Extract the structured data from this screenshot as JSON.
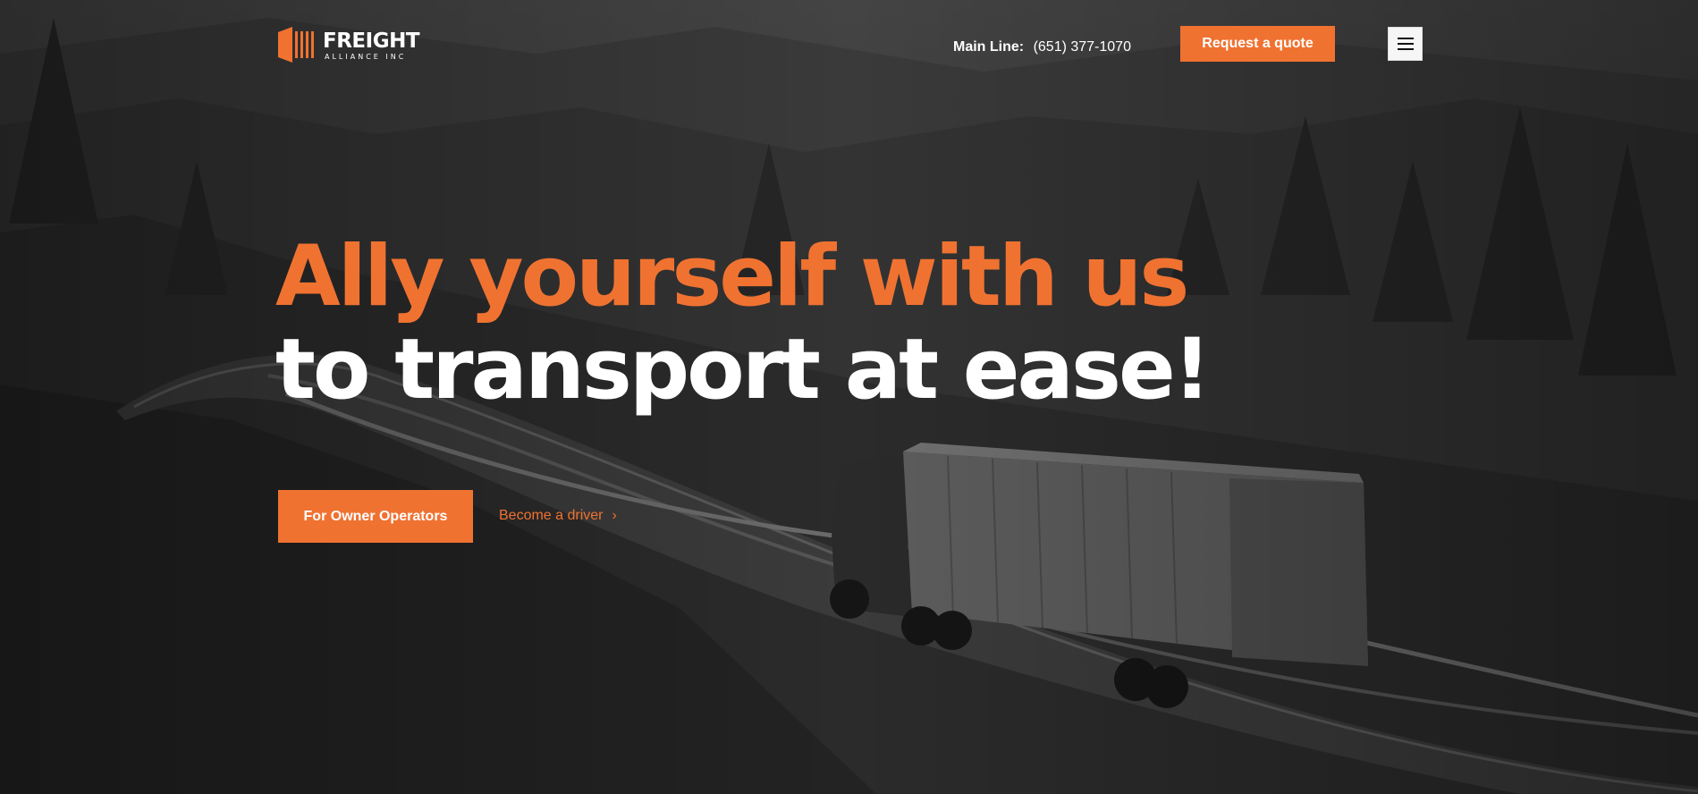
{
  "brand": {
    "name": "FREIGHT",
    "tagline": "ALLIANCE INC",
    "accent_color": "#f07231",
    "logo_icon": "freight-bars-logo"
  },
  "header": {
    "main_line_label": "Main Line:",
    "main_line_phone": "(651) 377-1070",
    "quote_button_label": "Request a quote",
    "menu_icon": "hamburger-menu-icon"
  },
  "hero": {
    "headline_line1": "Ally yourself with us",
    "headline_line2": "to transport at ease!",
    "primary_cta_label": "For Owner Operators",
    "secondary_cta_label": "Become a driver",
    "secondary_cta_icon": "chevron-right-icon",
    "background_image": "semi truck on winding mountain highway"
  }
}
